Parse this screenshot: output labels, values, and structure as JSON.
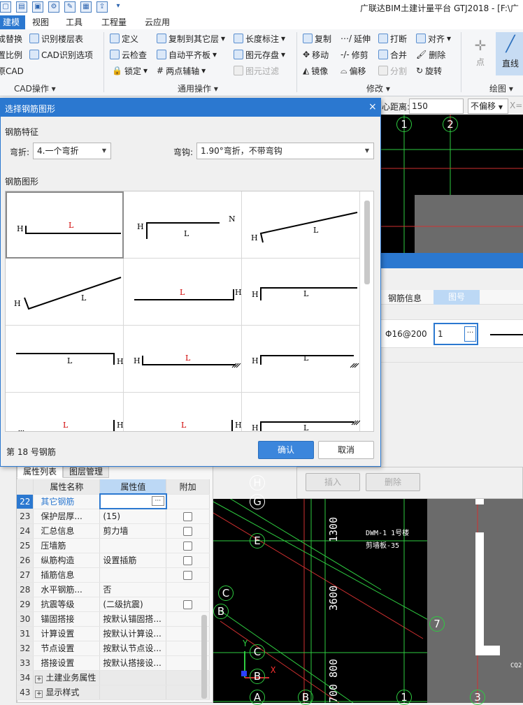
{
  "app": {
    "title": "广联达BIM土建计量平台 GTJ2018 - [F:\\广"
  },
  "menu_tabs": [
    "建模",
    "视图",
    "工具",
    "工程量",
    "云应用"
  ],
  "ribbon": {
    "cad_group": {
      "items": [
        "成替换",
        "识别楼层表",
        "置比例",
        "CAD识别选项",
        "原CAD"
      ],
      "label": "CAD操作"
    },
    "common_group": {
      "items": [
        "定义",
        "复制到其它层",
        "长度标注",
        "云检查",
        "自动平齐板",
        "图元存盘",
        "锁定",
        "两点辅轴",
        "图元过滤"
      ],
      "label": "通用操作"
    },
    "modify_group": {
      "items": [
        "复制",
        "延伸",
        "打断",
        "对齐",
        "移动",
        "修剪",
        "合并",
        "删除",
        "镜像",
        "偏移",
        "分割",
        "旋转"
      ],
      "label": "修改"
    },
    "draw_group": {
      "items": [
        "点",
        "直线"
      ],
      "label": "绘图"
    }
  },
  "toolbar2": {
    "offset_label": "心距离:",
    "offset_value": "150",
    "offset_mode": "不偏移",
    "xlabel": "X="
  },
  "dialog": {
    "title": "选择钢筋图形",
    "section_feature": "钢筋特征",
    "bend_label": "弯折:",
    "bend_value": "4.一个弯折",
    "hook_label": "弯钩:",
    "hook_value": "1.90°弯折，不带弯钩",
    "section_shape": "钢筋图形",
    "status": "第 18 号钢筋",
    "ok_label": "确认",
    "cancel_label": "取消",
    "shape_letters": {
      "h": "H",
      "l": "L",
      "n": "N"
    }
  },
  "rebar_table": {
    "headers": [
      "钢筋信息",
      "图号"
    ],
    "row": {
      "info": "Φ16@200",
      "figure": "1",
      "more": "···"
    },
    "insert_label": "插入",
    "delete_label": "删除"
  },
  "prop_panel": {
    "tabs": [
      "属性列表",
      "图层管理"
    ],
    "headers": [
      "属性名称",
      "属性值",
      "附加"
    ],
    "rows": [
      {
        "num": "22",
        "name": "其它钢筋",
        "value": "",
        "check": false,
        "more": "···"
      },
      {
        "num": "23",
        "name": "保护层厚...",
        "value": "(15)",
        "check": true
      },
      {
        "num": "24",
        "name": "汇总信息",
        "value": "剪力墙",
        "check": true
      },
      {
        "num": "25",
        "name": "压墙筋",
        "value": "",
        "check": true
      },
      {
        "num": "26",
        "name": "纵筋构造",
        "value": "设置插筋",
        "check": true
      },
      {
        "num": "27",
        "name": "插筋信息",
        "value": "",
        "check": true
      },
      {
        "num": "28",
        "name": "水平钢筋...",
        "value": "否",
        "check": false
      },
      {
        "num": "29",
        "name": "抗震等级",
        "value": "(二级抗震)",
        "check": true
      },
      {
        "num": "30",
        "name": "锚固搭接",
        "value": "按默认锚固搭...",
        "check": false
      },
      {
        "num": "31",
        "name": "计算设置",
        "value": "按默认计算设...",
        "check": false
      },
      {
        "num": "32",
        "name": "节点设置",
        "value": "按默认节点设...",
        "check": false
      },
      {
        "num": "33",
        "name": "搭接设置",
        "value": "按默认搭接设...",
        "check": false
      },
      {
        "num": "34",
        "name": "土建业务属性",
        "value": "",
        "check": false,
        "expand": "+"
      },
      {
        "num": "43",
        "name": "显示样式",
        "value": "",
        "check": false,
        "expand": "+"
      }
    ]
  },
  "cad": {
    "axes_top": [
      "1",
      "2"
    ],
    "axes_left": [
      "H",
      "G",
      "E",
      "C",
      "B",
      "C",
      "B",
      "A",
      "B",
      "1",
      "3",
      "7"
    ],
    "dims": [
      "1300",
      "3600",
      "700",
      "800"
    ],
    "notes": [
      "DWM-1 1号楼",
      "剪墙板-35",
      "CQ2"
    ],
    "xy": {
      "x": "X",
      "y": "Y"
    }
  }
}
